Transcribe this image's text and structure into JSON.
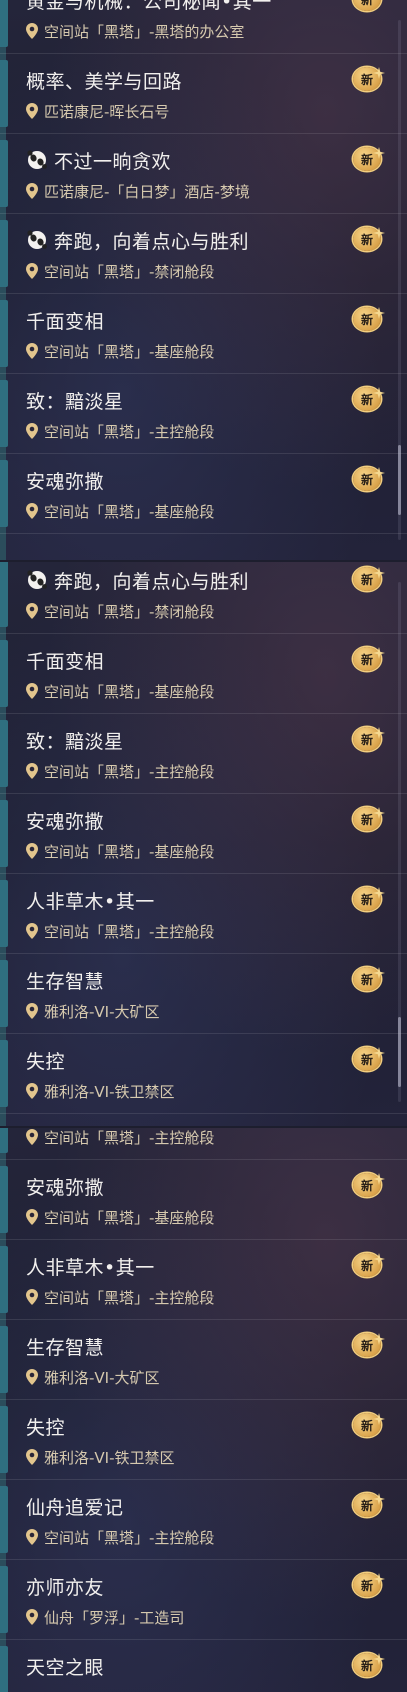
{
  "new_label": "新",
  "colors": {
    "title": "#f2f0ee",
    "location": "#d6c9ae",
    "badge_gold": "#e3b25d",
    "row_bar": "#2f6f80"
  },
  "panels": [
    {
      "items": [
        {
          "title": "黄金与机械：公司秘闻•其一",
          "location": "空间站「黑塔」-黑塔的办公室",
          "icon": "none"
        },
        {
          "title": "概率、美学与回路",
          "location": "匹诺康尼-晖长石号",
          "icon": "none"
        },
        {
          "title": "不过一晌贪欢",
          "location": "匹诺康尼-「白日梦」酒店-梦境",
          "icon": "panda-icon"
        },
        {
          "title": "奔跑，向着点心与胜利",
          "location": "空间站「黑塔」-禁闭舱段",
          "icon": "panda-icon"
        },
        {
          "title": "千面变相",
          "location": "空间站「黑塔」-基座舱段",
          "icon": "none"
        },
        {
          "title": "致：黯淡星",
          "location": "空间站「黑塔」-主控舱段",
          "icon": "none"
        },
        {
          "title": "安魂弥撒",
          "location": "空间站「黑塔」-基座舱段",
          "icon": "none"
        }
      ]
    },
    {
      "items": [
        {
          "title": "奔跑，向着点心与胜利",
          "location": "空间站「黑塔」-禁闭舱段",
          "icon": "panda-icon"
        },
        {
          "title": "千面变相",
          "location": "空间站「黑塔」-基座舱段",
          "icon": "none"
        },
        {
          "title": "致：黯淡星",
          "location": "空间站「黑塔」-主控舱段",
          "icon": "none"
        },
        {
          "title": "安魂弥撒",
          "location": "空间站「黑塔」-基座舱段",
          "icon": "none"
        },
        {
          "title": "人非草木•其一",
          "location": "空间站「黑塔」-主控舱段",
          "icon": "none"
        },
        {
          "title": "生存智慧",
          "location": "雅利洛-VI-大矿区",
          "icon": "none"
        },
        {
          "title": "失控",
          "location": "雅利洛-VI-铁卫禁区",
          "icon": "none"
        }
      ]
    },
    {
      "items": [
        {
          "title": "",
          "location": "空间站「黑塔」-主控舱段",
          "icon": "none"
        },
        {
          "title": "安魂弥撒",
          "location": "空间站「黑塔」-基座舱段",
          "icon": "none"
        },
        {
          "title": "人非草木•其一",
          "location": "空间站「黑塔」-主控舱段",
          "icon": "none"
        },
        {
          "title": "生存智慧",
          "location": "雅利洛-VI-大矿区",
          "icon": "none"
        },
        {
          "title": "失控",
          "location": "雅利洛-VI-铁卫禁区",
          "icon": "none"
        },
        {
          "title": "仙舟追爱记",
          "location": "空间站「黑塔」-主控舱段",
          "icon": "none"
        },
        {
          "title": "亦师亦友",
          "location": "仙舟「罗浮」-工造司",
          "icon": "none"
        },
        {
          "title": "天空之眼",
          "location": "",
          "icon": "none"
        }
      ]
    }
  ]
}
